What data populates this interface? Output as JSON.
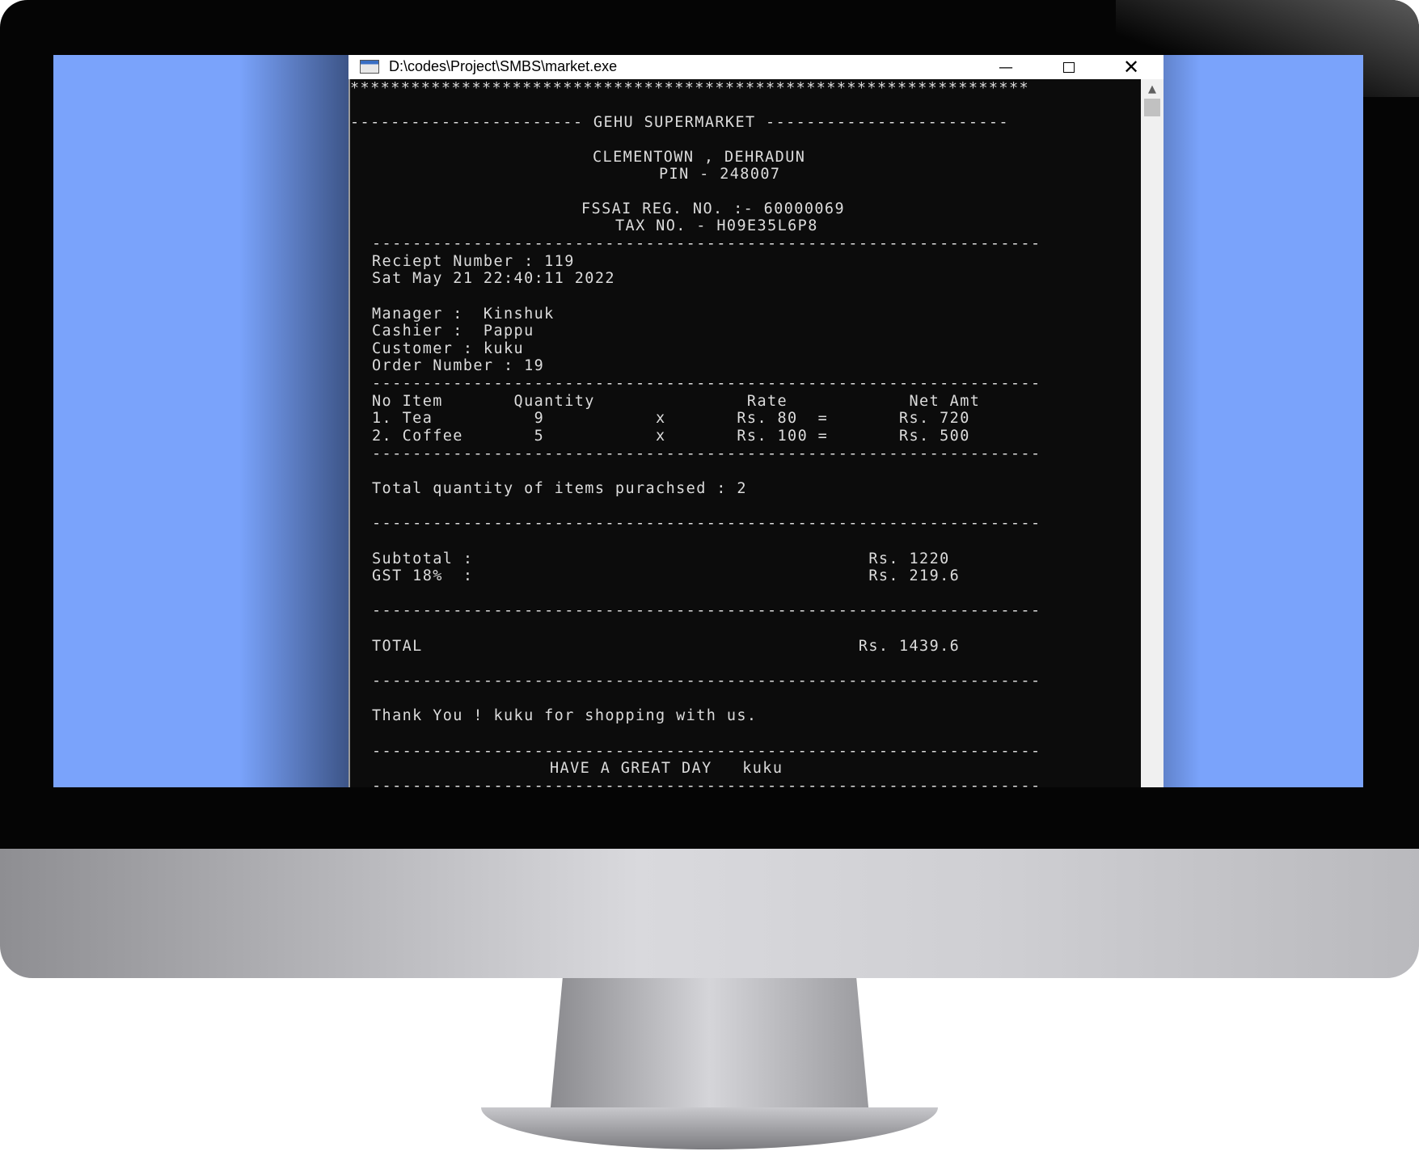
{
  "window": {
    "title": "D:\\codes\\Project\\SMBS\\market.exe",
    "minimize_glyph": "—",
    "close_glyph": "✕"
  },
  "console": {
    "stars": "*******************************************************************",
    "header": "----------------------- GEHU SUPERMARKET ------------------------",
    "address": "CLEMENTOWN , DEHRADUN",
    "pin": "PIN - 248007",
    "fssai": "FSSAI REG. NO. :- 60000069",
    "tax": "TAX NO. - H09E35L6P8",
    "separator": "------------------------------------------------------------------",
    "receipt_number": "Reciept Number : 119",
    "date": "Sat May 21 22:40:11 2022",
    "manager": "Manager :  Kinshuk",
    "cashier": "Cashier :  Pappu",
    "customer": "Customer : kuku",
    "order_number": "Order Number : 19",
    "table_header": "No Item       Quantity               Rate            Net Amt",
    "items": [
      "1. Tea          9           x       Rs. 80  =       Rs. 720",
      "2. Coffee       5           x       Rs. 100 =       Rs. 500"
    ],
    "total_qty": "Total quantity of items purachsed : 2",
    "subtotal": "Subtotal :                                       Rs. 1220",
    "gst": "GST 18%  :                                       Rs. 219.6",
    "total": "TOTAL                                           Rs. 1439.6",
    "thanks": "Thank You ! kuku for shopping with us.",
    "great_day": "HAVE A GREAT DAY   kuku"
  },
  "scrollbar": {
    "up_glyph": "▲"
  }
}
